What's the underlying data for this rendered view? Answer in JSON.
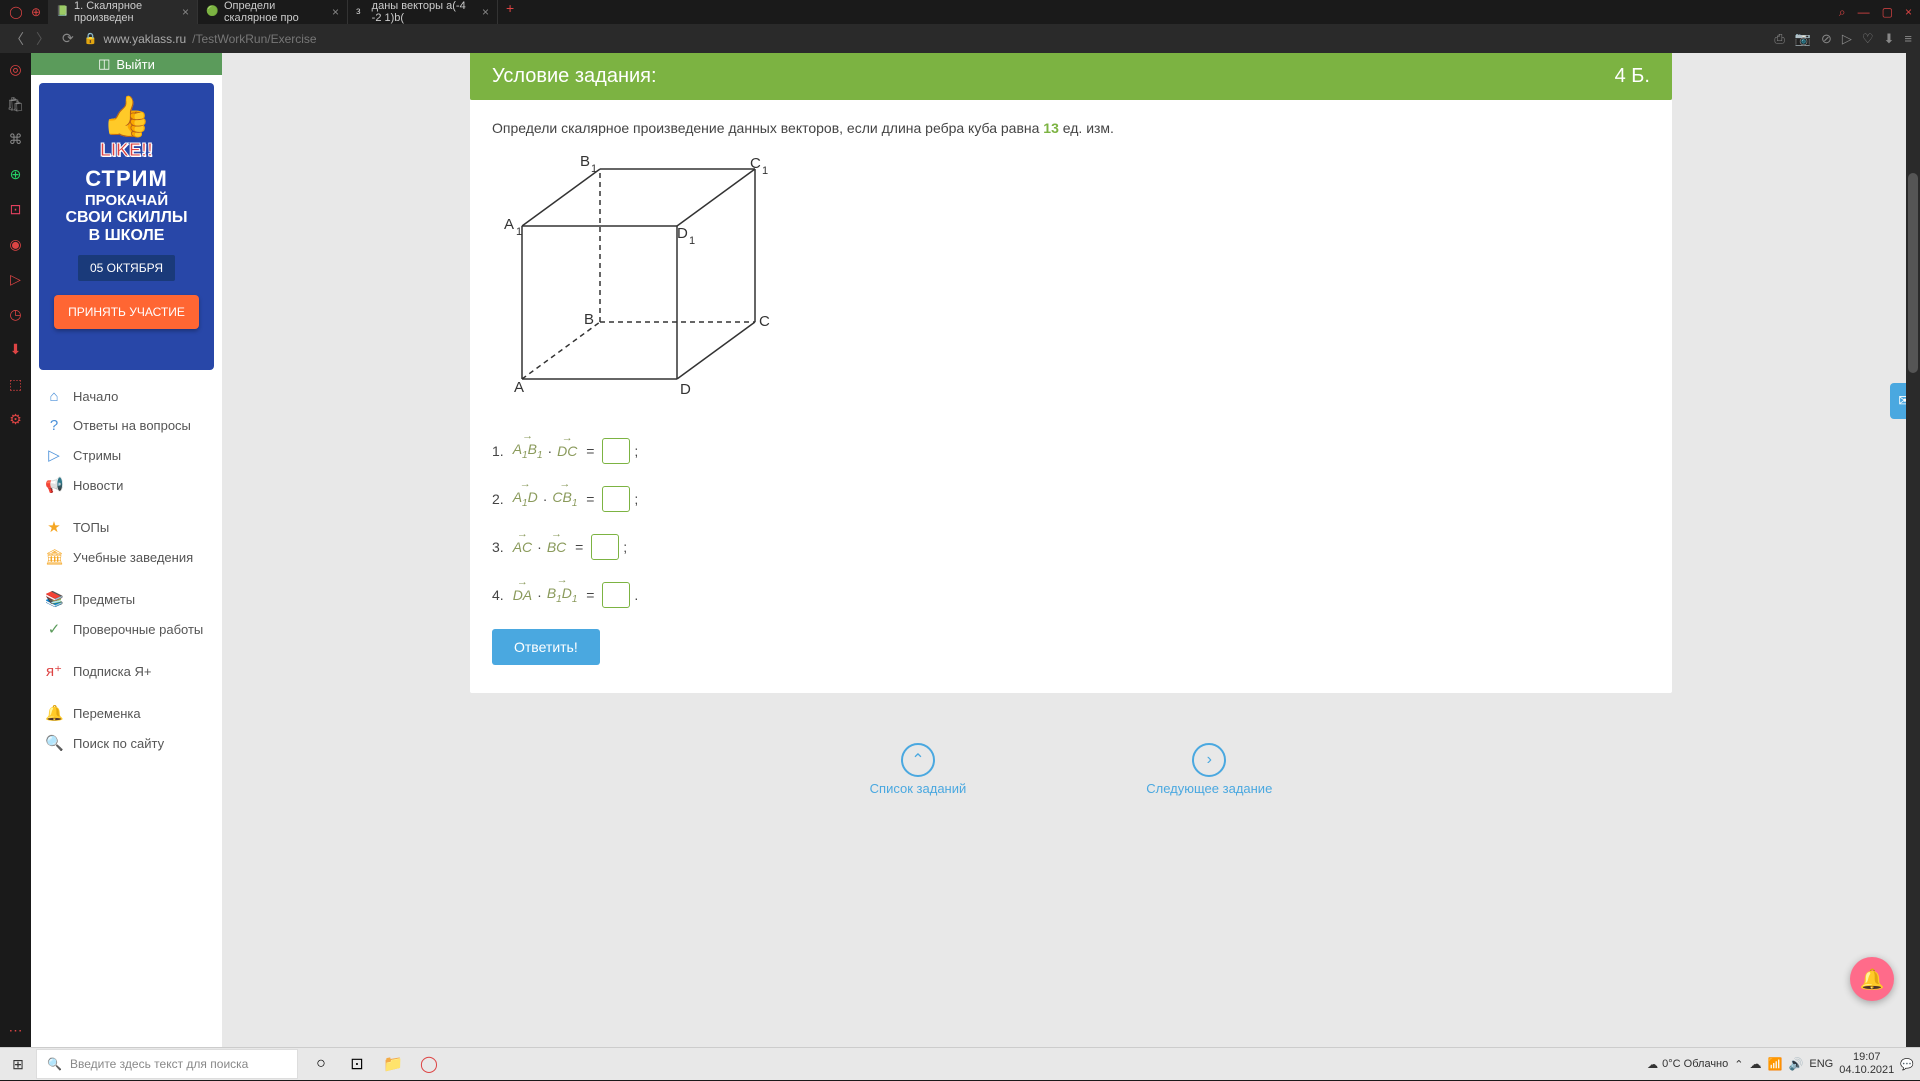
{
  "tabs": [
    {
      "icon": "📗",
      "label": "1. Скалярное произведен"
    },
    {
      "icon": "🟢",
      "label": "Определи скалярное про"
    },
    {
      "icon": "з",
      "label": "даны векторы a(-4 -2 1)b("
    }
  ],
  "url_host": "www.yaklass.ru",
  "url_path": "/TestWorkRun/Exercise",
  "sidebar": {
    "exit": "Выйти",
    "ad": {
      "like": "LIKE!!",
      "l1": "СТРИМ",
      "l2": "ПРОКАЧАЙ",
      "l3": "СВОИ СКИЛЛЫ",
      "l4": "В ШКОЛЕ",
      "date": "05 ОКТЯБРЯ",
      "btn": "ПРИНЯТЬ УЧАСТИЕ"
    },
    "items": [
      {
        "icon": "⌂",
        "cls": "ico-home",
        "label": "Начало"
      },
      {
        "icon": "?",
        "cls": "ico-q",
        "label": "Ответы на вопросы"
      },
      {
        "icon": "▷",
        "cls": "ico-play",
        "label": "Стримы"
      },
      {
        "icon": "📢",
        "cls": "ico-news",
        "label": "Новости"
      },
      {
        "sep": true
      },
      {
        "icon": "★",
        "cls": "ico-star",
        "label": "ТОПы"
      },
      {
        "icon": "🏛",
        "cls": "ico-edu",
        "label": "Учебные заведения"
      },
      {
        "sep": true
      },
      {
        "icon": "📚",
        "cls": "ico-sub",
        "label": "Предметы"
      },
      {
        "icon": "✓",
        "cls": "ico-check",
        "label": "Проверочные работы"
      },
      {
        "sep": true
      },
      {
        "icon": "я⁺",
        "cls": "ico-yap",
        "label": "Подписка Я+"
      },
      {
        "sep": true
      },
      {
        "icon": "🔔",
        "cls": "ico-bell",
        "label": "Переменка"
      },
      {
        "icon": "🔍",
        "cls": "ico-search",
        "label": "Поиск по сайту"
      }
    ]
  },
  "task": {
    "header": "Условие задания:",
    "points": "4 Б.",
    "text_pre": "Определи скалярное произведение данных векторов, если длина ребра куба равна ",
    "edge": "13",
    "text_post": " ед. изм.",
    "cube_labels": {
      "A": "A",
      "B": "B",
      "C": "C",
      "D": "D",
      "A1": "A",
      "B1": "B",
      "C1": "C",
      "D1": "D",
      "s1": "1"
    },
    "eq": [
      {
        "n": "1.",
        "v1": "A₁B₁",
        "v2": "DC"
      },
      {
        "n": "2.",
        "v1": "A₁D",
        "v2": "CB₁"
      },
      {
        "n": "3.",
        "v1": "AC",
        "v2": "BC"
      },
      {
        "n": "4.",
        "v1": "DA",
        "v2": "B₁D₁"
      }
    ],
    "answer_btn": "Ответить!"
  },
  "bottom_nav": {
    "list": "Список заданий",
    "next": "Следующее задание"
  },
  "taskbar": {
    "search": "Введите здесь текст для поиска",
    "weather": "0°C Облачно",
    "lang": "ENG",
    "time": "19:07",
    "date": "04.10.2021"
  }
}
